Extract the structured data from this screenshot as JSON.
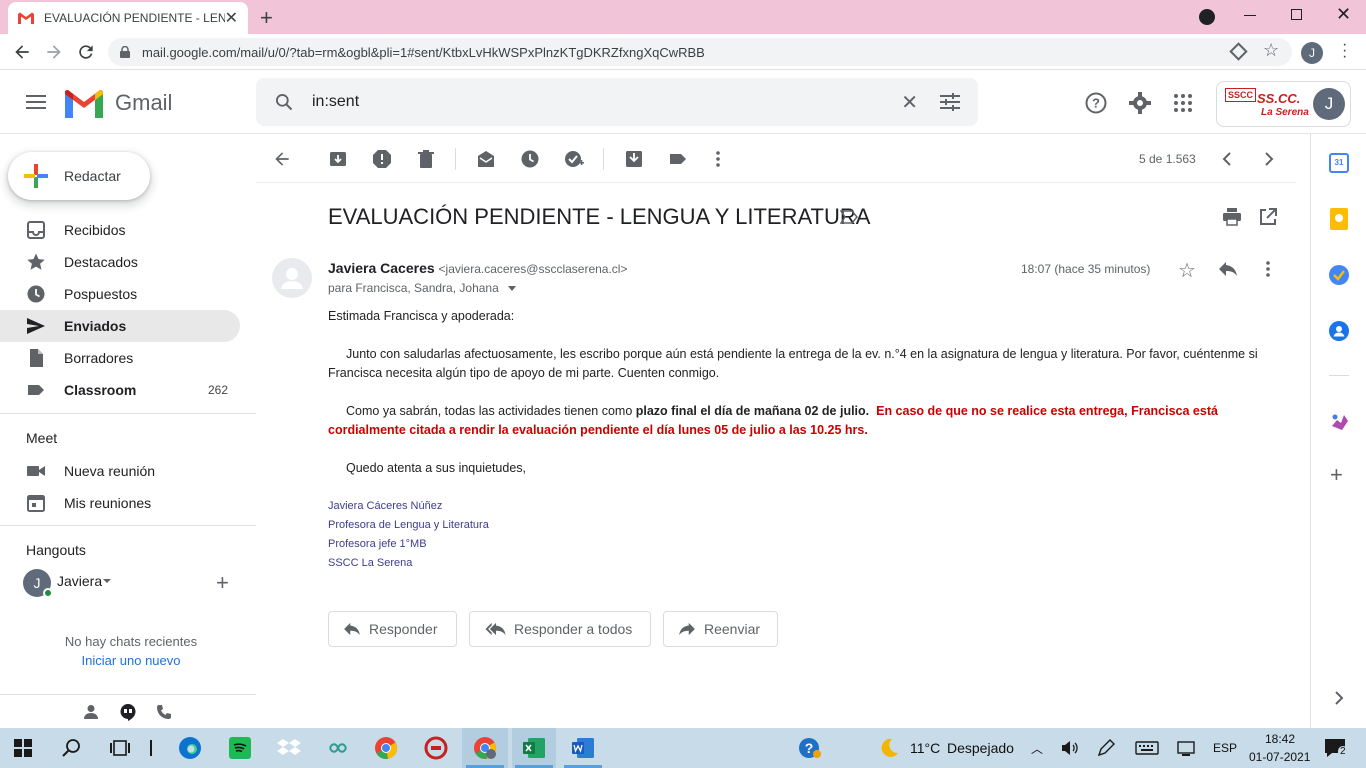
{
  "browser": {
    "tab_title": "EVALUACIÓN PENDIENTE - LENG",
    "url": "mail.google.com/mail/u/0/?tab=rm&ogbl&pli=1#sent/KtbxLvHkWSPxPlnzKTgDKRZfxngXqCwRBB",
    "profile_initial": "J"
  },
  "header": {
    "brand": "Gmail",
    "search_value": "in:sent",
    "org_logo_text": "SS.CC.",
    "org_logo_sub": "La Serena",
    "org_logo_badge": "SSCC",
    "avatar_initial": "J"
  },
  "sidebar": {
    "compose_label": "Redactar",
    "items": [
      {
        "label": "Recibidos",
        "icon": "inbox-icon",
        "count": ""
      },
      {
        "label": "Destacados",
        "icon": "star-icon",
        "count": ""
      },
      {
        "label": "Pospuestos",
        "icon": "clock-icon",
        "count": ""
      },
      {
        "label": "Enviados",
        "icon": "send-icon",
        "count": ""
      },
      {
        "label": "Borradores",
        "icon": "draft-icon",
        "count": ""
      },
      {
        "label": "Classroom",
        "icon": "label-icon",
        "count": "262"
      }
    ],
    "meet_title": "Meet",
    "meet_items": [
      {
        "label": "Nueva reunión",
        "icon": "videocam-icon"
      },
      {
        "label": "Mis reuniones",
        "icon": "calendar-icon"
      }
    ],
    "hangouts_title": "Hangouts",
    "hangouts_user": "Javiera",
    "hangouts_user_initial": "J",
    "no_chats": "No hay chats recientes",
    "start_new": "Iniciar uno nuevo"
  },
  "toolbar": {
    "pagination": "5 de 1.563"
  },
  "message": {
    "subject": "EVALUACIÓN PENDIENTE - LENGUA Y LITERATURA",
    "sender_name": "Javiera Caceres",
    "sender_email": "<javiera.caceres@sscclaserena.cl>",
    "to": "para Francisca, Sandra, Johana",
    "time": "18:07 (hace 35 minutos)",
    "greeting": "Estimada Francisca y apoderada:",
    "para1": "Junto con saludarlas afectuosamente, les escribo porque aún está pendiente la entrega de la ev. n.°4 en la asignatura de lengua y literatura. Por favor, cuéntenme si Francisca necesita algún tipo de apoyo de mi parte. Cuenten conmigo.",
    "para2_a": "Como ya sabrán, todas las actividades tienen como ",
    "para2_bold": "plazo final el día de mañana 02 de julio.",
    "para2_red": "En caso de que no se realice esta entrega, Francisca está cordialmente citada a rendir la evaluación pendiente el día lunes 05 de julio a las 10.25 hrs.",
    "closing": "Quedo atenta a sus inquietudes,",
    "signature": [
      "Javiera Cáceres Núñez",
      "Profesora de Lengua y Literatura",
      "Profesora jefe 1°MB",
      "SSCC La Serena"
    ]
  },
  "actions": {
    "reply": "Responder",
    "reply_all": "Responder a todos",
    "forward": "Reenviar"
  },
  "taskbar": {
    "weather_temp": "11°C",
    "weather_desc": "Despejado",
    "lang": "ESP",
    "time": "18:42",
    "date": "01-07-2021",
    "notif_count": "2"
  },
  "colors": {
    "tab_bar": "#f2c4d8",
    "taskbar": "#c7dbe8",
    "highlight_red": "#cc0000",
    "signature": "#3d3d8f"
  }
}
